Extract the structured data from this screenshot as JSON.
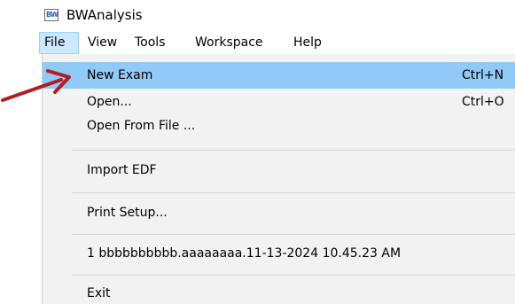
{
  "window": {
    "app_icon_text": "BW",
    "title": "BWAnalysis"
  },
  "menubar": {
    "items": [
      {
        "label": "File"
      },
      {
        "label": "View"
      },
      {
        "label": "Tools"
      },
      {
        "label": "Workspace"
      },
      {
        "label": "Help"
      }
    ],
    "active_item": "File"
  },
  "file_menu": {
    "items": [
      {
        "label": "New Exam",
        "shortcut": "Ctrl+N"
      },
      {
        "label": "Open...",
        "shortcut": "Ctrl+O"
      },
      {
        "label": "Open From File ..."
      },
      {
        "label": "Import EDF"
      },
      {
        "label": "Print Setup..."
      },
      {
        "label": "1 bbbbbbbbbb.aaaaaaaa.11-13-2024 10.45.23 AM"
      },
      {
        "label": "Exit"
      }
    ],
    "highlighted_item": "New Exam"
  },
  "colors": {
    "highlight": "#91c9f7",
    "menu_background": "#f2f2f2",
    "active_menu_header": "#cce8ff",
    "annotation_arrow": "#b01e23"
  },
  "annotation": {
    "icon": "red-arrow-icon",
    "points_to": "New Exam"
  }
}
